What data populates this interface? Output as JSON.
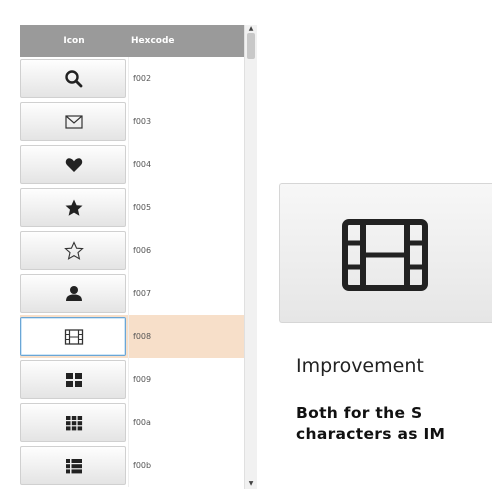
{
  "table": {
    "header_icon": "Icon",
    "header_hex": "Hexcode",
    "rows": [
      {
        "icon": "search-icon",
        "hex": "f002"
      },
      {
        "icon": "envelope-icon",
        "hex": "f003"
      },
      {
        "icon": "heart-icon",
        "hex": "f004"
      },
      {
        "icon": "star-icon",
        "hex": "f005"
      },
      {
        "icon": "star-outline-icon",
        "hex": "f006"
      },
      {
        "icon": "user-icon",
        "hex": "f007"
      },
      {
        "icon": "film-icon",
        "hex": "f008",
        "selected": true
      },
      {
        "icon": "th-large-icon",
        "hex": "f009"
      },
      {
        "icon": "th-icon",
        "hex": "f00a"
      },
      {
        "icon": "th-list-icon",
        "hex": "f00b"
      }
    ]
  },
  "preview": {
    "icon": "film-icon"
  },
  "content": {
    "heading": "Improvement",
    "line1": "Both for the S",
    "line2": "characters as IM"
  },
  "colors": {
    "selected_row": "#f7dfc9",
    "header_bg": "#9a9a9a"
  }
}
